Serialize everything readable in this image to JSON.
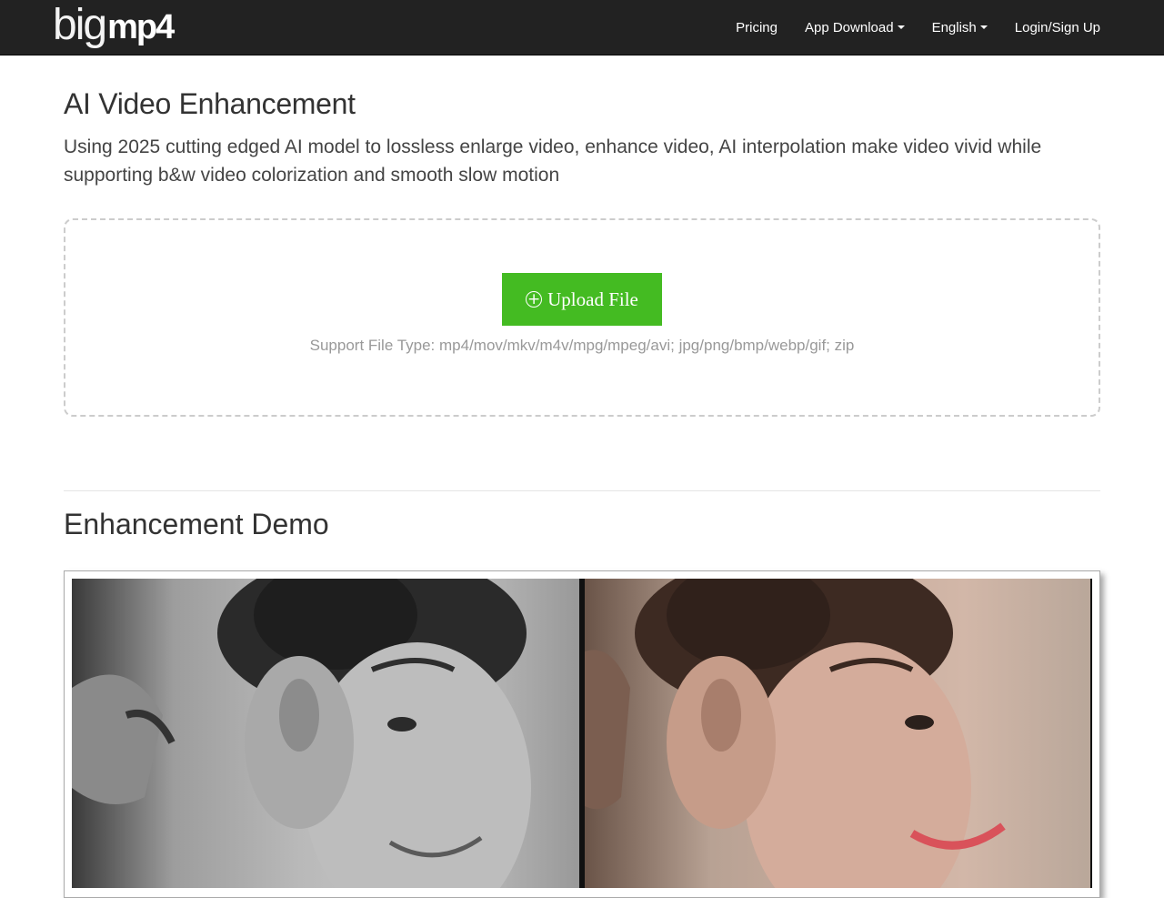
{
  "navbar": {
    "logo": {
      "big": "big",
      "mp4": "mp4"
    },
    "items": [
      {
        "label": "Pricing",
        "has_caret": false
      },
      {
        "label": "App Download",
        "has_caret": true
      },
      {
        "label": "English",
        "has_caret": true
      },
      {
        "label": "Login/Sign Up",
        "has_caret": false
      }
    ]
  },
  "hero": {
    "title": "AI Video Enhancement",
    "subtitle": "Using 2025 cutting edged AI model to lossless enlarge video, enhance video, AI interpolation make video vivid while supporting b&w video colorization and smooth slow motion"
  },
  "upload": {
    "button_label": "Upload File",
    "support_text": "Support File Type: mp4/mov/mkv/m4v/mpg/mpeg/avi; jpg/png/bmp/webp/gif; zip"
  },
  "demo": {
    "title": "Enhancement Demo"
  },
  "colors": {
    "navbar_bg": "#222222",
    "upload_button": "#44bb22",
    "support_text": "#999999"
  }
}
